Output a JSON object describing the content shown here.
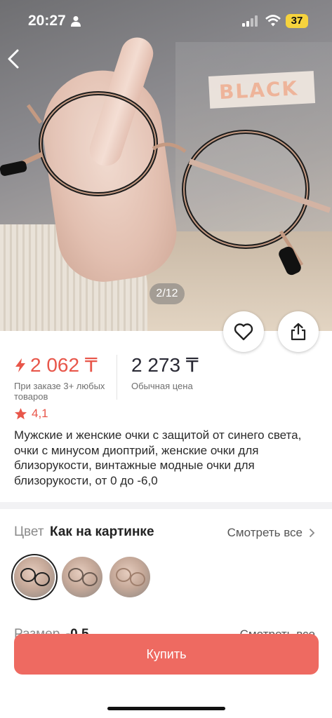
{
  "status_bar": {
    "time": "20:27",
    "battery": "37"
  },
  "gallery": {
    "counter": "2/12",
    "overlay_text": "BLACK"
  },
  "price": {
    "sale_price": "2 062 ₸",
    "sale_note": "При заказе 3+ любых товаров",
    "regular_price": "2 273 ₸",
    "regular_note": "Обычная цена",
    "sale_color": "#e8564a"
  },
  "rating": {
    "value": "4,1"
  },
  "product": {
    "title": "Мужские и женские очки с защитой от синего света, очки с минусом диоптрий, женские очки для близорукости, винтажные модные очки для близорукости, от 0 до -6,0"
  },
  "color_section": {
    "label": "Цвет",
    "value": "Как на картинке",
    "see_all": "Смотреть все"
  },
  "size_section": {
    "label": "Размер",
    "value": "-0,5",
    "see_all": "Смотреть все"
  },
  "actions": {
    "buy": "Купить",
    "buy_color": "#ee6a61"
  },
  "icons": [
    "person-icon",
    "signal-icon",
    "wifi-icon",
    "back-arrow-icon",
    "heart-icon",
    "share-icon",
    "bolt-icon",
    "star-icon",
    "chevron-right-icon"
  ]
}
